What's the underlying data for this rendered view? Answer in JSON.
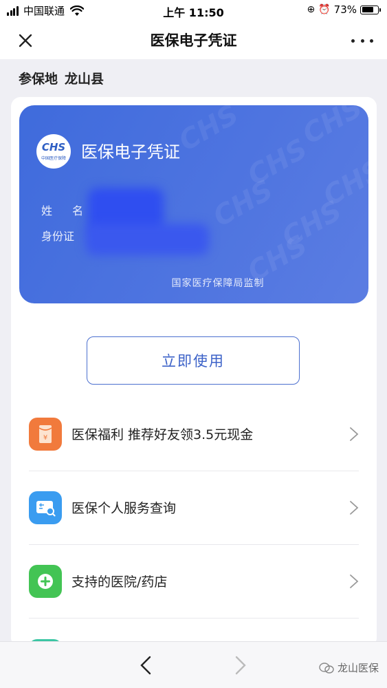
{
  "status_bar": {
    "carrier": "中国联通",
    "time": "上午 11:50",
    "battery_percent": "73%",
    "battery_level": 0.73
  },
  "nav": {
    "title": "医保电子凭证",
    "close_icon": "close-icon",
    "more_icon": "more-icon"
  },
  "location": {
    "label": "参保地",
    "value": "龙山县"
  },
  "card": {
    "logo_text": "CHS",
    "logo_sub": "中国医疗保障",
    "title": "医保电子凭证",
    "name_label": "姓 名",
    "id_label": "身份证",
    "footer": "国家医疗保障局监制",
    "colors": {
      "start": "#3f6bdc",
      "end": "#5b7de2"
    }
  },
  "use_button": {
    "label": "立即使用"
  },
  "menu": {
    "items": [
      {
        "label": "医保福利 推荐好友领3.5元现金",
        "icon": "red-envelope-icon",
        "color": "#f17a3c"
      },
      {
        "label": "医保个人服务查询",
        "icon": "id-card-search-icon",
        "color": "#3a9cf0"
      },
      {
        "label": "支持的医院/药店",
        "icon": "plus-cross-icon",
        "color": "#43c454"
      }
    ]
  },
  "bottom_bar": {
    "back_icon": "back-arrow-icon",
    "forward_icon": "forward-arrow-icon",
    "watermark": "龙山医保"
  }
}
